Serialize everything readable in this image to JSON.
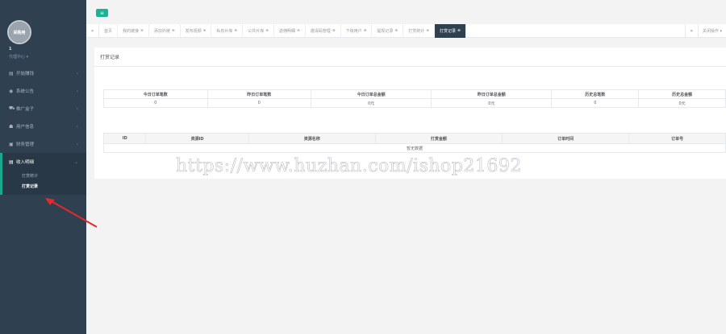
{
  "profile": {
    "avatar_text": "采购用",
    "name": "1",
    "role": "代理中心 ▾"
  },
  "sidebar": {
    "items": [
      {
        "icon": "▤",
        "label": "开始赚钱",
        "arrow": "‹"
      },
      {
        "icon": "◉",
        "label": "系统公告",
        "arrow": "‹"
      },
      {
        "icon": "⛟",
        "label": "推广盒子",
        "arrow": "‹"
      },
      {
        "icon": "☗",
        "label": "用户信息",
        "arrow": "‹"
      },
      {
        "icon": "▣",
        "label": "财务管理",
        "arrow": "‹"
      },
      {
        "icon": "▤",
        "label": "收入明细",
        "arrow": "⌄"
      }
    ],
    "sub_items": [
      {
        "label": "打赏统计"
      },
      {
        "label": "打赏记录"
      }
    ]
  },
  "topbar": {
    "menu_icon": "≡"
  },
  "tabs": {
    "left_nav": "«",
    "right_nav": "»",
    "close_ops": "关闭操作 ▾",
    "items": [
      {
        "label": "首页",
        "close": ""
      },
      {
        "label": "我的链接",
        "close": "⊗"
      },
      {
        "label": "添加外链",
        "close": "⊗"
      },
      {
        "label": "发布视频",
        "close": "⊗"
      },
      {
        "label": "私有片库",
        "close": "⊗"
      },
      {
        "label": "公共片库",
        "close": "⊗"
      },
      {
        "label": "返佣明细",
        "close": "⊗"
      },
      {
        "label": "邀请码管理",
        "close": "⊗"
      },
      {
        "label": "下级用户",
        "close": "⊗"
      },
      {
        "label": "提现记录",
        "close": "⊗"
      },
      {
        "label": "打赏统计",
        "close": "⊗"
      },
      {
        "label": "打赏记录",
        "close": "⊗"
      }
    ]
  },
  "panel": {
    "title": "打赏记录"
  },
  "stats": {
    "headers": [
      "今日订单笔数",
      "昨日订单笔数",
      "今日订单总金额",
      "昨日订单总金额",
      "历史总笔数",
      "历史总金额"
    ],
    "values": [
      "0",
      "0",
      "0元",
      "0元",
      "0",
      "0元"
    ]
  },
  "records": {
    "headers": [
      "ID",
      "资源ID",
      "资源名称",
      "打赏金额",
      "订单时间",
      "订单号"
    ],
    "empty_text": "暂无数据"
  },
  "watermark": "https://www.huzhan.com/ishop21692",
  "colors": {
    "sidebar_bg": "#2f4050",
    "accent": "#1ab394",
    "annotation_arrow": "#e8282b"
  }
}
